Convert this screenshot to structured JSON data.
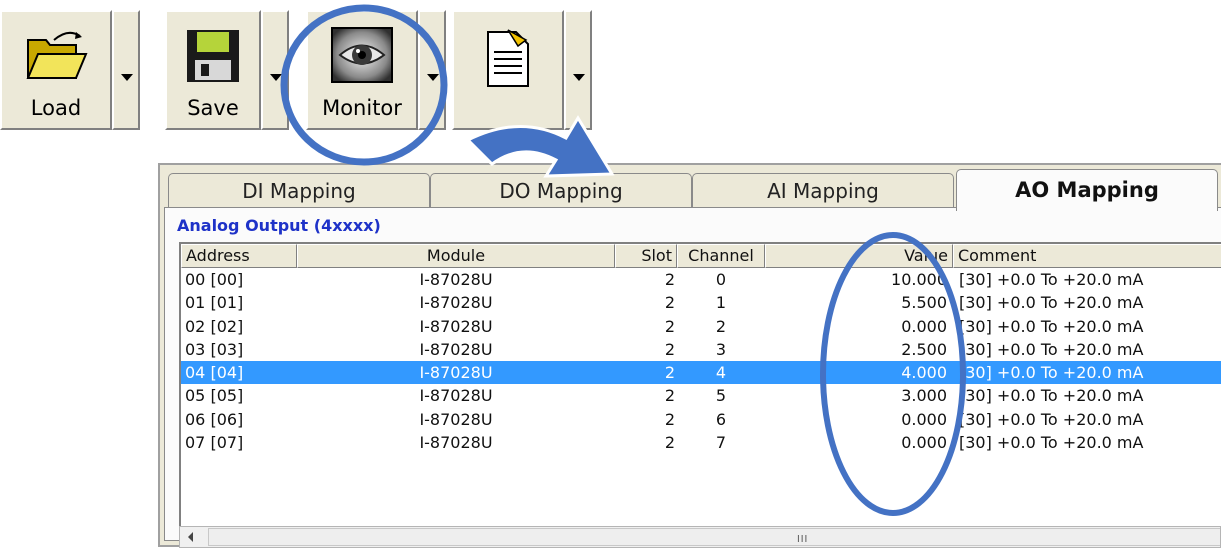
{
  "toolbar": {
    "load_label": "Load",
    "save_label": "Save",
    "monitor_label": "Monitor"
  },
  "tabs": [
    {
      "label": "DI Mapping"
    },
    {
      "label": "DO Mapping"
    },
    {
      "label": "AI Mapping"
    },
    {
      "label": "AO Mapping"
    }
  ],
  "section_title": "Analog Output  (4xxxx)",
  "columns": {
    "address": "Address",
    "module": "Module",
    "slot": "Slot",
    "channel": "Channel",
    "value": "Value",
    "comment": "Comment"
  },
  "rows": [
    {
      "address": "00 [00]",
      "module": "I-87028U",
      "slot": "2",
      "channel": "0",
      "value": "10.000",
      "comment": "[30] +0.0 To +20.0 mA"
    },
    {
      "address": "01 [01]",
      "module": "I-87028U",
      "slot": "2",
      "channel": "1",
      "value": "5.500",
      "comment": "[30] +0.0 To +20.0 mA"
    },
    {
      "address": "02 [02]",
      "module": "I-87028U",
      "slot": "2",
      "channel": "2",
      "value": "0.000",
      "comment": "[30] +0.0 To +20.0 mA"
    },
    {
      "address": "03 [03]",
      "module": "I-87028U",
      "slot": "2",
      "channel": "3",
      "value": "2.500",
      "comment": "[30] +0.0 To +20.0 mA"
    },
    {
      "address": "04 [04]",
      "module": "I-87028U",
      "slot": "2",
      "channel": "4",
      "value": "4.000",
      "comment": "[30] +0.0 To +20.0 mA"
    },
    {
      "address": "05 [05]",
      "module": "I-87028U",
      "slot": "2",
      "channel": "5",
      "value": "3.000",
      "comment": "[30] +0.0 To +20.0 mA"
    },
    {
      "address": "06 [06]",
      "module": "I-87028U",
      "slot": "2",
      "channel": "6",
      "value": "0.000",
      "comment": "[30] +0.0 To +20.0 mA"
    },
    {
      "address": "07 [07]",
      "module": "I-87028U",
      "slot": "2",
      "channel": "7",
      "value": "0.000",
      "comment": "[30] +0.0 To +20.0 mA"
    }
  ],
  "selected_row": 4,
  "scroll_grip": "III",
  "colors": {
    "selection": "#3399ff",
    "section_title": "#1e32c8",
    "annotation": "#4472c4"
  },
  "icons": {
    "load": "folder-open-icon",
    "save": "floppy-disk-icon",
    "monitor": "eye-icon",
    "document": "document-edit-icon"
  }
}
